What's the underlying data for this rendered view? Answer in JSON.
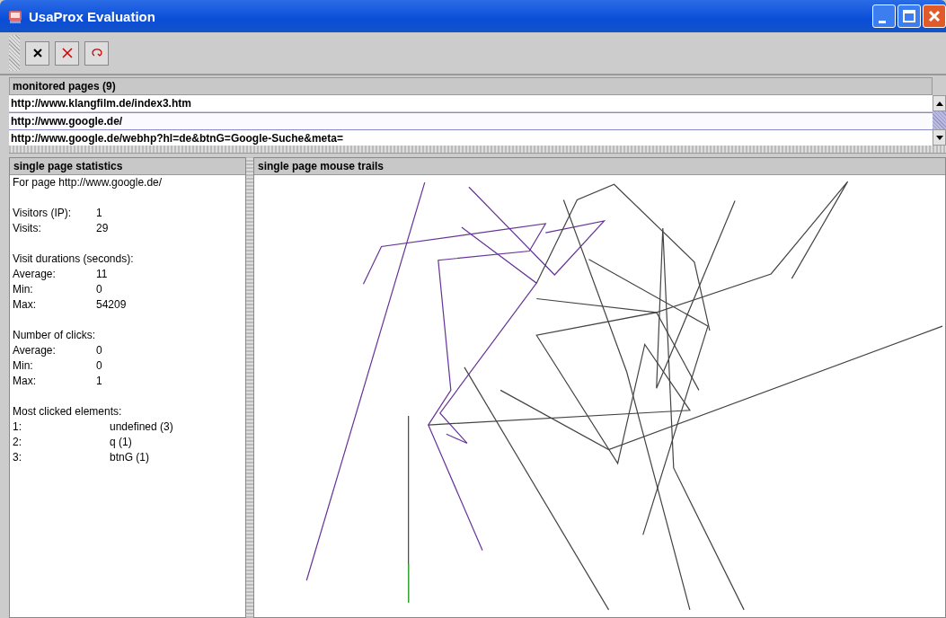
{
  "window": {
    "title": "UsaProx Evaluation"
  },
  "toolbar": [
    {
      "kind": "close"
    },
    {
      "kind": "delete"
    },
    {
      "kind": "reload"
    }
  ],
  "monitored_pages": {
    "header": "monitored pages (9)",
    "rows": [
      {
        "url": "http://www.klangfilm.de/index3.htm",
        "selected": false
      },
      {
        "url": "http://www.google.de/",
        "selected": true
      },
      {
        "url": "http://www.google.de/webhp?hl=de&btnG=Google-Suche&meta=",
        "selected": false
      }
    ]
  },
  "statistics": {
    "header": "single page statistics",
    "page_line": "For page http://www.google.de/",
    "groups": [
      {
        "rows": [
          {
            "label": "Visitors (IP):",
            "value": "1"
          },
          {
            "label": "Visits:",
            "value": "29"
          }
        ]
      },
      {
        "heading": "Visit durations (seconds):",
        "rows": [
          {
            "label": "Average:",
            "value": "11"
          },
          {
            "label": "Min:",
            "value": "0"
          },
          {
            "label": "Max:",
            "value": "54209"
          }
        ]
      },
      {
        "heading": "Number of clicks:",
        "rows": [
          {
            "label": "Average:",
            "value": "0"
          },
          {
            "label": "Min:",
            "value": "0"
          },
          {
            "label": "Max:",
            "value": "1"
          }
        ]
      },
      {
        "heading": "Most clicked elements:",
        "wide": true,
        "rows": [
          {
            "label": "1:",
            "value": "undefined (3)"
          },
          {
            "label": "2:",
            "value": "q (1)"
          },
          {
            "label": "3:",
            "value": "btnG (1)"
          }
        ]
      }
    ]
  },
  "mouse_trails": {
    "header": "single page mouse trails"
  }
}
